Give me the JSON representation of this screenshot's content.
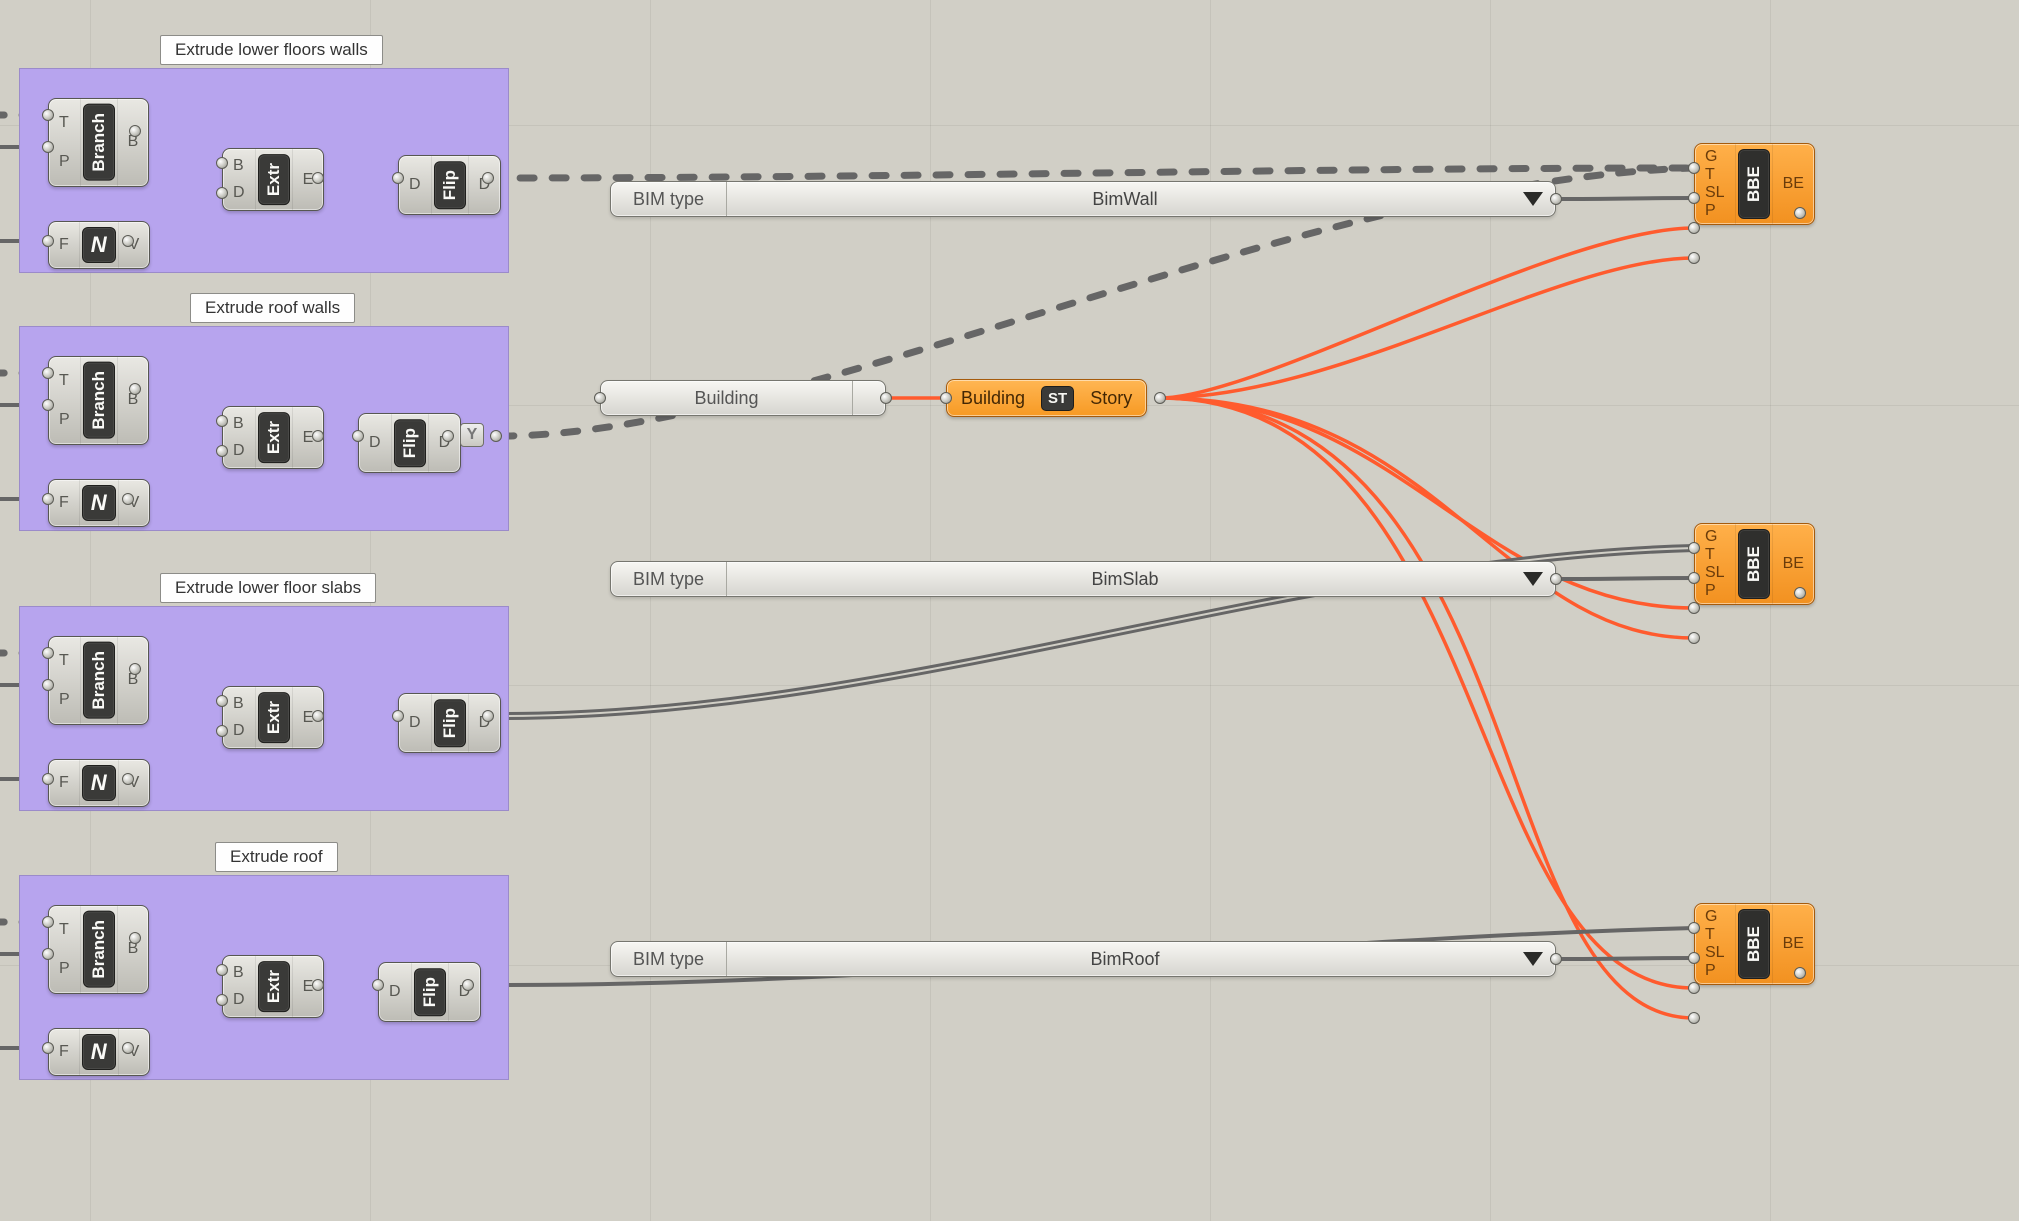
{
  "groups": [
    {
      "label": "Extrude lower floors walls"
    },
    {
      "label": "Extrude roof walls"
    },
    {
      "label": "Extrude lower floor slabs"
    },
    {
      "label": "Extrude roof"
    }
  ],
  "components": {
    "branch": {
      "name": "Branch",
      "in": [
        "T",
        "P"
      ],
      "out": [
        "B"
      ]
    },
    "neg": {
      "name": "N",
      "in": [
        "F"
      ],
      "out": [
        "V"
      ]
    },
    "extr": {
      "name": "Extr",
      "in": [
        "B",
        "D"
      ],
      "out": [
        "E"
      ]
    },
    "flip": {
      "name": "Flip",
      "in": [
        "D"
      ],
      "out": [
        "D"
      ]
    },
    "bbe": {
      "name": "BBE",
      "in": [
        "G",
        "T",
        "SL",
        "P"
      ],
      "out": [
        "BE"
      ]
    },
    "story": {
      "name": "ST",
      "in_label": "Building",
      "out_label": "Story"
    },
    "ytoggle": "Y"
  },
  "panels": {
    "bim_type_label": "BIM type",
    "building_label": "Building",
    "wall": "BimWall",
    "slab": "BimSlab",
    "roof": "BimRoof"
  }
}
